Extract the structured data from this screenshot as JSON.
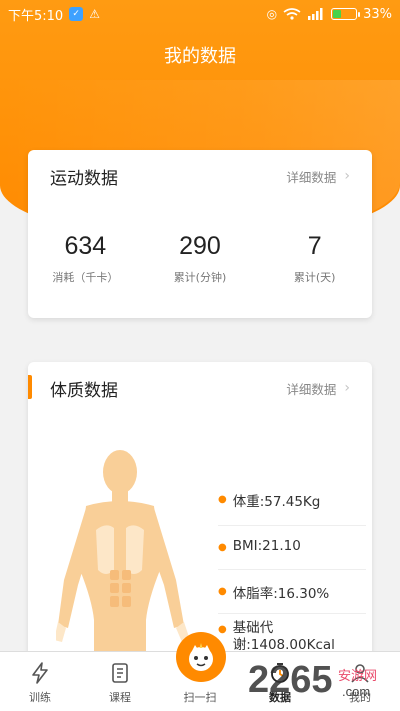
{
  "status": {
    "time": "下午5:10",
    "battery": "33%",
    "battery_level": 0.33
  },
  "header": {
    "title": "我的数据"
  },
  "sports_card": {
    "title": "运动数据",
    "detail_label": "详细数据",
    "stats": [
      {
        "value": "634",
        "label": "消耗（千卡）"
      },
      {
        "value": "290",
        "label": "累计(分钟)"
      },
      {
        "value": "7",
        "label": "累计(天)"
      }
    ]
  },
  "body_card": {
    "title": "体质数据",
    "detail_label": "详细数据",
    "metrics": [
      {
        "text": "体重:57.45Kg"
      },
      {
        "text": "BMI:21.10"
      },
      {
        "text": "体脂率:16.30%"
      },
      {
        "text": "基础代谢:1408.00Kcal"
      }
    ]
  },
  "nav": {
    "items": [
      {
        "label": "训练",
        "icon": "lightning-icon"
      },
      {
        "label": "课程",
        "icon": "document-icon"
      },
      {
        "label": "扫一扫",
        "icon": "scan-mascot-icon"
      },
      {
        "label": "数据",
        "icon": "chart-clock-icon",
        "active": true
      },
      {
        "label": "我的",
        "icon": "user-icon"
      }
    ]
  },
  "watermark": {
    "text": "2265.com",
    "sub": "安游网"
  },
  "colors": {
    "accent": "#ff8a00",
    "hero": "#ff9b12",
    "body": "#f8c789"
  }
}
